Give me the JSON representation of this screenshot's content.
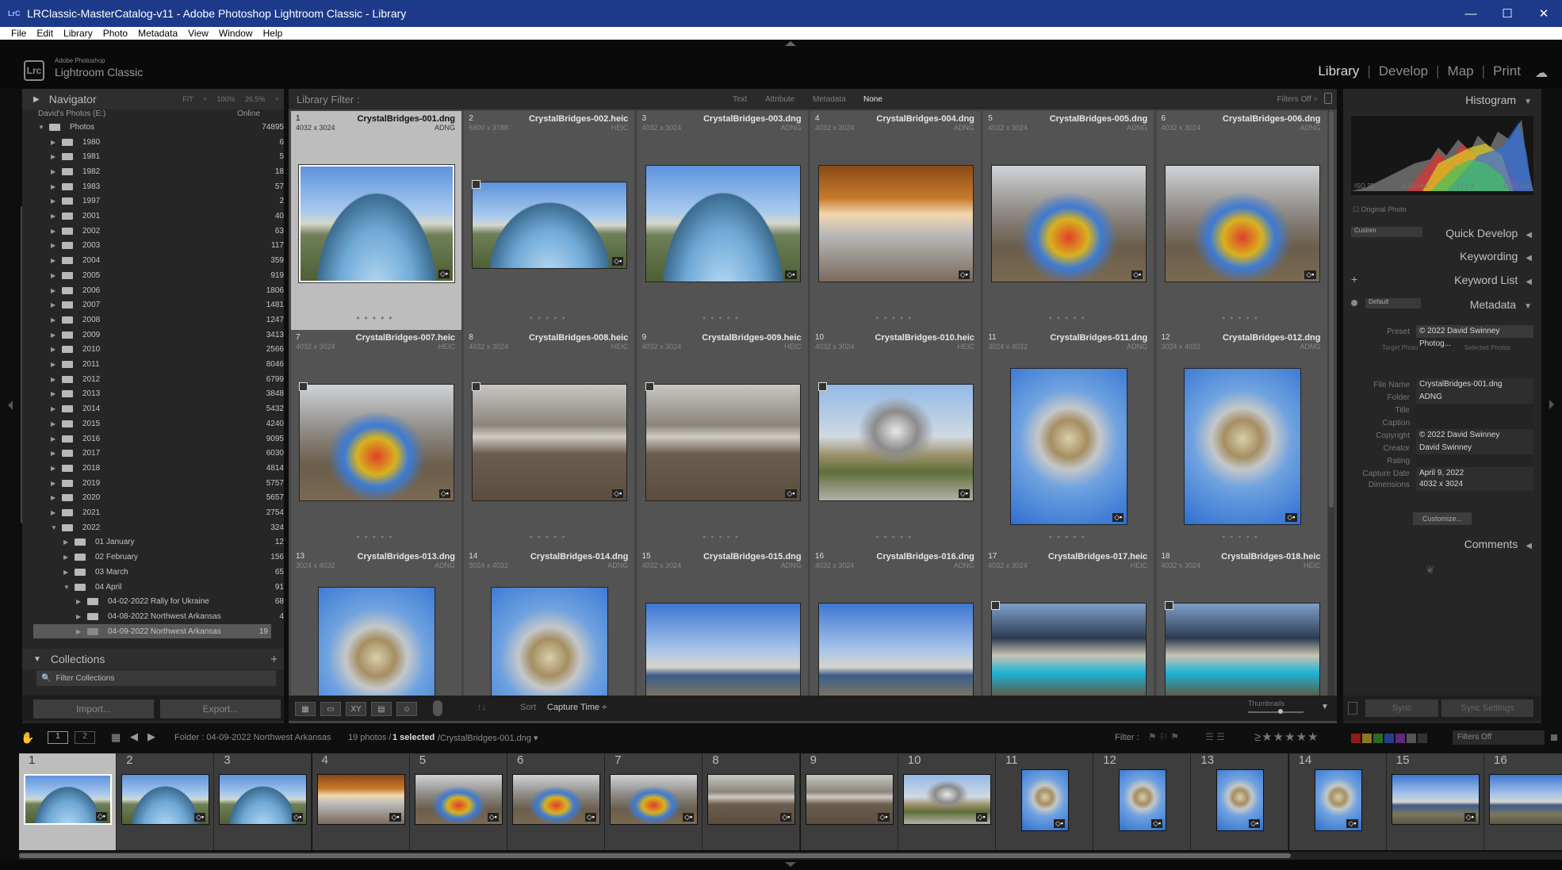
{
  "window": {
    "title": "LRClassic-MasterCatalog-v11 - Adobe Photoshop Lightroom Classic - Library",
    "controls": [
      "—",
      "☐",
      "✕"
    ]
  },
  "menu": [
    "File",
    "Edit",
    "Library",
    "Photo",
    "Metadata",
    "View",
    "Window",
    "Help"
  ],
  "brand": {
    "small": "Adobe Photoshop",
    "big": "Lightroom Classic",
    "logo": "Lrc"
  },
  "modules": [
    "Library",
    "Develop",
    "Map",
    "Print"
  ],
  "navigator": {
    "label": "Navigator",
    "options": "FIT ÷  100%  26.5% ÷"
  },
  "folders": {
    "root_label": "Photos",
    "root_count": "74895",
    "years": [
      [
        "1980",
        "6"
      ],
      [
        "1981",
        "5"
      ],
      [
        "1982",
        "18"
      ],
      [
        "1983",
        "57"
      ],
      [
        "1997",
        "2"
      ],
      [
        "2001",
        "40"
      ],
      [
        "2002",
        "63"
      ],
      [
        "2003",
        "117"
      ],
      [
        "2004",
        "359"
      ],
      [
        "2005",
        "919"
      ],
      [
        "2006",
        "1806"
      ],
      [
        "2007",
        "1481"
      ],
      [
        "2008",
        "1247"
      ],
      [
        "2009",
        "3413"
      ],
      [
        "2010",
        "2566"
      ],
      [
        "2011",
        "8046"
      ],
      [
        "2012",
        "6799"
      ],
      [
        "2013",
        "3848"
      ],
      [
        "2014",
        "5432"
      ],
      [
        "2015",
        "4240"
      ],
      [
        "2016",
        "9095"
      ],
      [
        "2017",
        "6030"
      ],
      [
        "2018",
        "4814"
      ],
      [
        "2019",
        "5757"
      ],
      [
        "2020",
        "5657"
      ],
      [
        "2021",
        "2754"
      ],
      [
        "2022",
        "324"
      ]
    ],
    "months": [
      [
        "01 January",
        "12"
      ],
      [
        "02 February",
        "156"
      ],
      [
        "03 March",
        "65"
      ],
      [
        "04 April",
        "91"
      ]
    ],
    "days": [
      [
        "04-02-2022 Rally for Ukraine",
        "68"
      ],
      [
        "04-08-2022 Northwest Arkansas",
        "4"
      ],
      [
        "04-09-2022 Northwest Arkansas",
        "19"
      ]
    ],
    "header_label": "David's Photos (E:)",
    "header_status": "Online"
  },
  "collections": {
    "label": "Collections",
    "filter_placeholder": "Filter Collections"
  },
  "left_buttons": {
    "import": "Import...",
    "export": "Export..."
  },
  "filter_bar": {
    "label": "Library Filter :",
    "options": [
      "Text",
      "Attribute",
      "Metadata",
      "None"
    ],
    "active": "None",
    "filters_off": "Filters Off ÷"
  },
  "grid": [
    {
      "n": "1",
      "file": "CrystalBridges-001.dng",
      "dim": "4032 x 3024",
      "ext": "ADNG",
      "scene": "dome",
      "sel": true
    },
    {
      "n": "2",
      "file": "CrystalBridges-002.heic",
      "dim": "6800 x 3788",
      "ext": "HEIC",
      "scene": "dome"
    },
    {
      "n": "3",
      "file": "CrystalBridges-003.dng",
      "dim": "4032 x 3024",
      "ext": "ADNG",
      "scene": "dome"
    },
    {
      "n": "4",
      "file": "CrystalBridges-004.dng",
      "dim": "4032 x 3024",
      "ext": "ADNG",
      "scene": "arch"
    },
    {
      "n": "5",
      "file": "CrystalBridges-005.dng",
      "dim": "4032 x 3024",
      "ext": "ADNG",
      "scene": "chihuly"
    },
    {
      "n": "6",
      "file": "CrystalBridges-006.dng",
      "dim": "4032 x 3024",
      "ext": "ADNG",
      "scene": "chihuly"
    },
    {
      "n": "7",
      "file": "CrystalBridges-007.heic",
      "dim": "4032 x 3024",
      "ext": "HEIC",
      "scene": "chihuly"
    },
    {
      "n": "8",
      "file": "CrystalBridges-008.heic",
      "dim": "4032 x 3024",
      "ext": "HEIC",
      "scene": "bridge"
    },
    {
      "n": "9",
      "file": "CrystalBridges-009.heic",
      "dim": "4032 x 3024",
      "ext": "HEIC",
      "scene": "bridge"
    },
    {
      "n": "10",
      "file": "CrystalBridges-010.heic",
      "dim": "4032 x 3024",
      "ext": "HEIC",
      "scene": "silver"
    },
    {
      "n": "11",
      "file": "CrystalBridges-011.dng",
      "dim": "3024 x 4032",
      "ext": "ADNG",
      "scene": "sun"
    },
    {
      "n": "12",
      "file": "CrystalBridges-012.dng",
      "dim": "3024 x 4032",
      "ext": "ADNG",
      "scene": "sun"
    },
    {
      "n": "13",
      "file": "CrystalBridges-013.dng",
      "dim": "3024 x 4032",
      "ext": "ADNG",
      "scene": "sun"
    },
    {
      "n": "14",
      "file": "CrystalBridges-014.dng",
      "dim": "3024 x 4032",
      "ext": "ADNG",
      "scene": "sun"
    },
    {
      "n": "15",
      "file": "CrystalBridges-015.dng",
      "dim": "4032 x 3024",
      "ext": "ADNG",
      "scene": "house"
    },
    {
      "n": "16",
      "file": "CrystalBridges-016.dng",
      "dim": "4032 x 3024",
      "ext": "ADNG",
      "scene": "house"
    },
    {
      "n": "17",
      "file": "CrystalBridges-017.heic",
      "dim": "4032 x 3024",
      "ext": "HEIC",
      "scene": "teal"
    },
    {
      "n": "18",
      "file": "CrystalBridges-018.heic",
      "dim": "4032 x 3024",
      "ext": "HEIC",
      "scene": "teal"
    }
  ],
  "toolbar": {
    "sort_label": "Sort",
    "sort_value": "Capture Time ÷",
    "thumbnails": "Thumbnails"
  },
  "right": {
    "histogram": "Histogram",
    "histo_info": [
      "ISO 25",
      "1.54 mm",
      "ƒ / 2.4",
      "1/580 sec"
    ],
    "original_photo": "Original Photo",
    "quick_develop": "Quick Develop",
    "qd_preset": "Custom",
    "keywording": "Keywording",
    "keyword_list": "Keyword List",
    "metadata": "Metadata",
    "md_preset": "Default",
    "preset_label": "Preset",
    "preset_value": "© 2022 David Swinney Photog...",
    "target_photo": "Target Photo",
    "selected_photos": "Selected Photos",
    "fields": [
      [
        "File Name",
        "CrystalBridges-001.dng"
      ],
      [
        "Folder",
        "ADNG"
      ],
      [
        "Title",
        ""
      ],
      [
        "Caption",
        ""
      ],
      [
        "Copyright",
        "© 2022 David Swinney"
      ],
      [
        "Creator",
        "David Swinney"
      ],
      [
        "Rating",
        ""
      ],
      [
        "Capture Date",
        "April 9, 2022"
      ],
      [
        "Dimensions",
        "4032 x 3024"
      ]
    ],
    "customize": "Customize...",
    "comments": "Comments"
  },
  "sync": {
    "sync": "Sync",
    "sync_settings": "Sync Settings"
  },
  "filmstrip_bar": {
    "pages": [
      "1",
      "2"
    ],
    "folder": "Folder : 04-09-2022 Northwest Arkansas",
    "count": "19 photos /",
    "selected": "1 selected",
    "current": "/CrystalBridges-001.dng ▾",
    "filter": "Filter :",
    "filters_off": "Filters Off"
  },
  "filmstrip": [
    {
      "n": "1",
      "scene": "dome",
      "sel": true
    },
    {
      "n": "2",
      "scene": "dome"
    },
    {
      "n": "3",
      "scene": "dome"
    },
    {
      "n": "4",
      "scene": "arch"
    },
    {
      "n": "5",
      "scene": "chihuly"
    },
    {
      "n": "6",
      "scene": "chihuly"
    },
    {
      "n": "7",
      "scene": "chihuly"
    },
    {
      "n": "8",
      "scene": "bridge"
    },
    {
      "n": "9",
      "scene": "bridge"
    },
    {
      "n": "10",
      "scene": "silver"
    },
    {
      "n": "11",
      "scene": "sun",
      "portrait": true
    },
    {
      "n": "12",
      "scene": "sun",
      "portrait": true
    },
    {
      "n": "13",
      "scene": "sun",
      "portrait": true
    },
    {
      "n": "14",
      "scene": "sun",
      "portrait": true
    },
    {
      "n": "15",
      "scene": "house"
    },
    {
      "n": "16",
      "scene": "house"
    }
  ]
}
